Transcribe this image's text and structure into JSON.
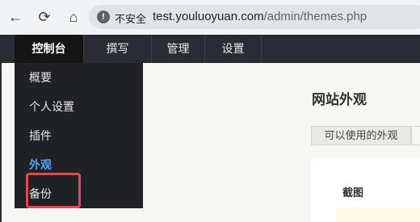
{
  "browser": {
    "back_icon": "←",
    "reload_icon": "⟳",
    "home_icon": "⌂",
    "security_icon": "!",
    "security_label": "不安全",
    "url_host": "test.youluoyuan.com",
    "url_path": "/admin/themes.php"
  },
  "admin": {
    "menu": [
      {
        "label": "控制台",
        "active": true
      },
      {
        "label": "撰写",
        "active": false
      },
      {
        "label": "管理",
        "active": false
      },
      {
        "label": "设置",
        "active": false
      }
    ],
    "dropdown": [
      {
        "label": "概要"
      },
      {
        "label": "个人设置"
      },
      {
        "label": "插件"
      },
      {
        "label": "外观",
        "current": true
      },
      {
        "label": "备份"
      }
    ]
  },
  "main": {
    "title": "网站外观",
    "tabs": [
      {
        "label": "可以使用的外观"
      }
    ],
    "table": {
      "headers": [
        "截图"
      ]
    }
  },
  "colors": {
    "header_bg": "#292d33",
    "dropdown_bg": "#202124",
    "current_item": "#4fa1f5",
    "highlight": "#e8464c"
  }
}
